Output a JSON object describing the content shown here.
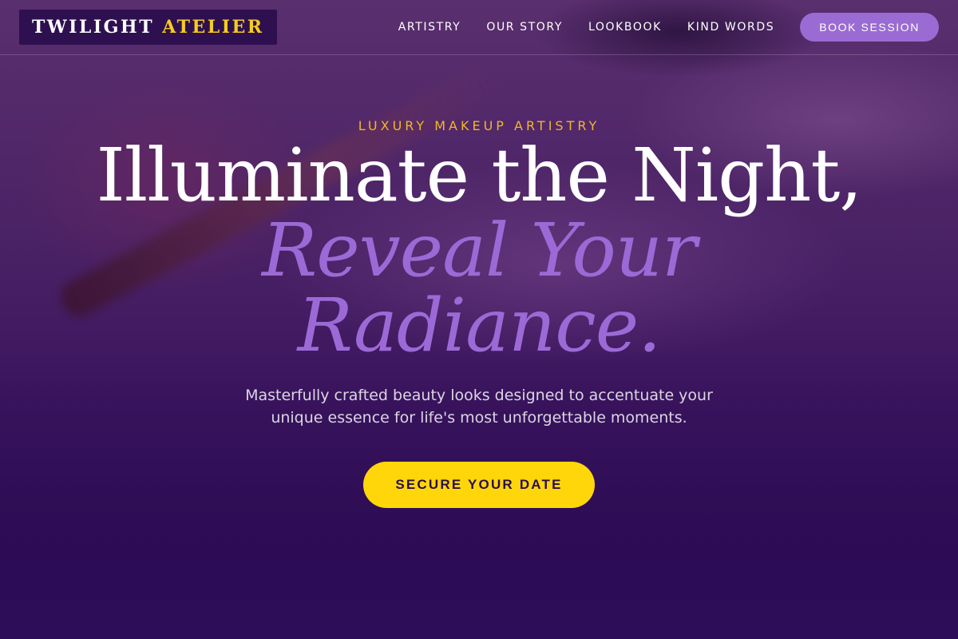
{
  "brand": {
    "name_primary": "TWILIGHT",
    "name_accent": "ATELIER"
  },
  "nav": {
    "links": [
      "ARTISTRY",
      "OUR STORY",
      "LOOKBOOK",
      "KIND WORDS"
    ],
    "cta_label": "BOOK SESSION"
  },
  "hero": {
    "eyebrow": "LUXURY MAKEUP ARTISTRY",
    "headline_line1": "Illuminate the Night,",
    "headline_line2": "Reveal Your",
    "headline_line3": "Radiance.",
    "subcopy": "Masterfully crafted beauty looks designed to accentuate your unique essence for life's most unforgettable moments.",
    "cta_label": "SECURE YOUR DATE"
  },
  "colors": {
    "accent_gold": "#f6cd1e",
    "accent_purple": "#9c6ad6",
    "background": "#2c0f55",
    "cta_yellow": "#ffd60a"
  }
}
